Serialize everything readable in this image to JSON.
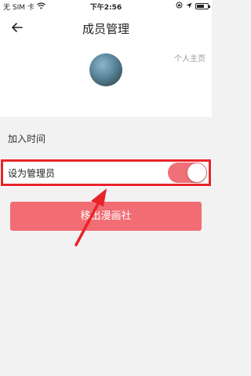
{
  "status_bar": {
    "carrier": "无 SIM 卡",
    "time": "下午2:56",
    "battery_level": 0.7
  },
  "nav": {
    "title": "成员管理",
    "back_icon": "back-arrow-icon"
  },
  "profile": {
    "link_label": "个人主页"
  },
  "rows": {
    "join_time_label": "加入时间",
    "admin_label": "设为管理员",
    "admin_enabled": true
  },
  "actions": {
    "remove_label": "移出漫画社"
  },
  "colors": {
    "accent": "#f16c73",
    "toggle_on": "#f07078",
    "annotation": "#e8242a"
  }
}
